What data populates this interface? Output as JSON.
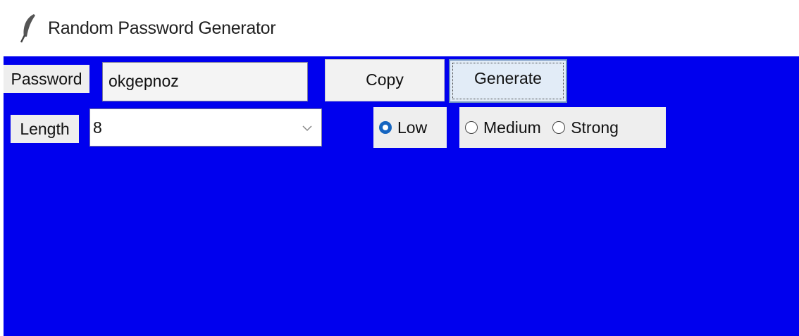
{
  "window": {
    "title": "Random Password Generator",
    "icon": "feather-icon"
  },
  "password_row": {
    "label": "Password",
    "value": "okgepnoz",
    "copy_label": "Copy",
    "generate_label": "Generate"
  },
  "length_row": {
    "label": "Length",
    "selected": "8"
  },
  "strength": {
    "options": [
      "Low",
      "Medium",
      "Strong"
    ],
    "selected": "Low"
  },
  "colors": {
    "background": "#0000ee",
    "radio_selected": "#1565c0"
  }
}
